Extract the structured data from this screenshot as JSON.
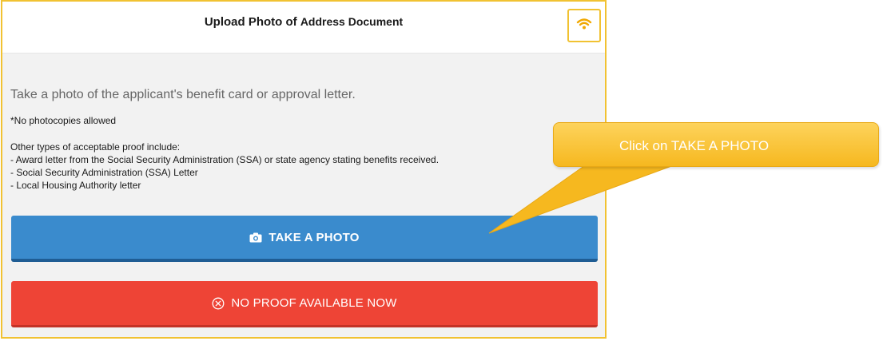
{
  "header": {
    "title_bold": "Upload Photo of",
    "title_rest": "Address Document",
    "wifi_icon": "wifi-icon"
  },
  "main": {
    "lead": "Take a photo of the applicant's benefit card or approval letter.",
    "note": "*No photocopies allowed",
    "proof_intro": "Other types of acceptable proof include:",
    "proof_items": [
      "- Award letter from the Social Security Administration (SSA) or state agency stating benefits received.",
      "- Social Security Administration (SSA) Letter",
      "- Local Housing Authority letter"
    ]
  },
  "buttons": {
    "take_photo": "TAKE A PHOTO",
    "take_photo_icon": "camera-icon",
    "no_proof": "NO PROOF AVAILABLE NOW",
    "no_proof_icon": "close-circle-icon"
  },
  "callout": {
    "text": "Click on TAKE A PHOTO"
  },
  "colors": {
    "frame_border": "#f1c232",
    "primary_button": "#3a8bcd",
    "danger_button": "#ee4436",
    "callout_fill": "#f6b81f"
  }
}
